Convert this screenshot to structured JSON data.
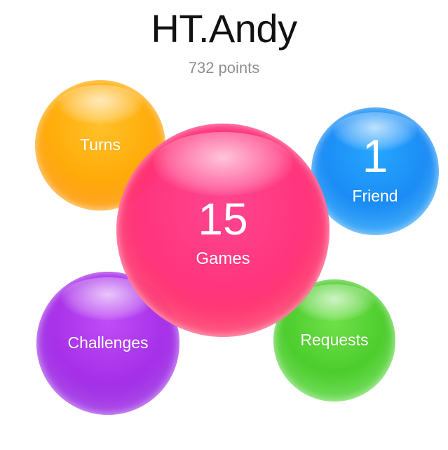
{
  "player": {
    "name": "HT.Andy",
    "points": "732 points"
  },
  "bubbles": {
    "turns": {
      "label": "Turns",
      "color": "#ffae0c"
    },
    "friends": {
      "count": "1",
      "label": "Friend",
      "color": "#1b8cf5"
    },
    "games": {
      "count": "15",
      "label": "Games",
      "color": "#ff2f7a"
    },
    "challenges": {
      "label": "Challenges",
      "color": "#a630e8"
    },
    "requests": {
      "label": "Requests",
      "color": "#4ccd2c"
    }
  }
}
